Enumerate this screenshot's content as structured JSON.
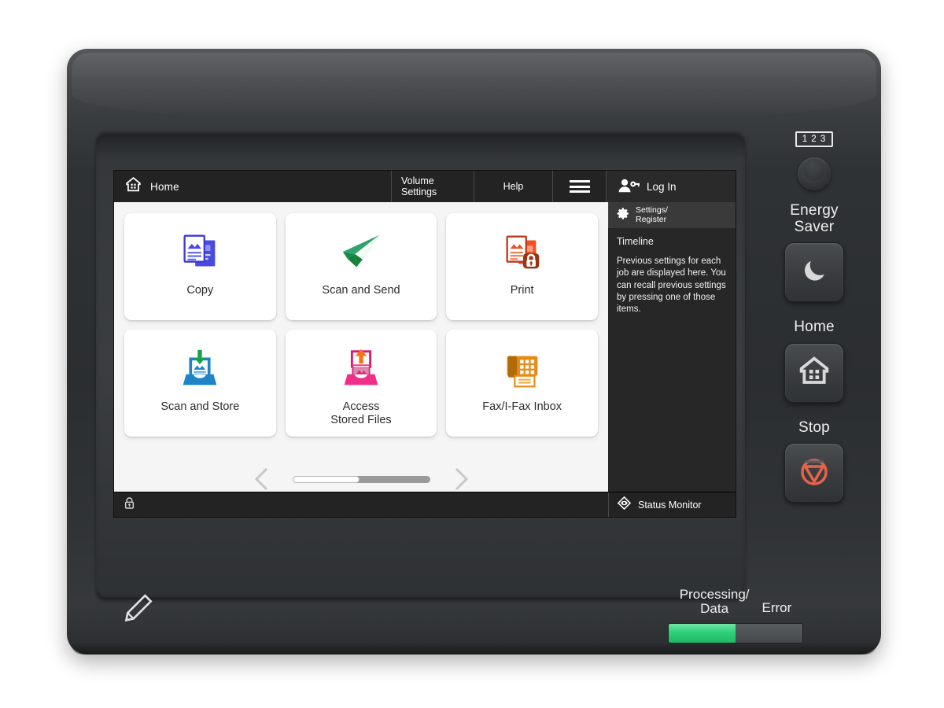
{
  "device": {
    "name": "multifunction-printer-control-panel"
  },
  "topbar": {
    "home_label": "Home",
    "home_icon": "home-icon",
    "volume_settings": "Volume Settings",
    "help": "Help",
    "menu_icon": "hamburger-menu-icon",
    "login_label": "Log In",
    "login_icon": "user-key-icon"
  },
  "tiles": [
    {
      "label": "Copy",
      "icon": "copy-documents-icon",
      "color": "#4a4ae0"
    },
    {
      "label": "Scan and Send",
      "icon": "paper-plane-icon",
      "color": "#1a8a4e"
    },
    {
      "label": "Print",
      "icon": "print-secure-documents-icon",
      "color": "#d4411e"
    },
    {
      "label": "Scan and Store",
      "icon": "scan-store-tray-icon",
      "color": "#1d84c8"
    },
    {
      "label": "Access\nStored Files",
      "label_line1": "Access",
      "label_line2": "Stored Files",
      "icon": "access-stored-files-tray-icon",
      "color": "#ef2f88"
    },
    {
      "label": "Fax/I-Fax Inbox",
      "icon": "fax-machine-icon",
      "color": "#e88a16"
    }
  ],
  "pager": {
    "prev_icon": "chevron-left-icon",
    "next_icon": "chevron-right-icon",
    "scroll_position_percent": 49
  },
  "sidepanel": {
    "settings_line1": "Settings/",
    "settings_line2": "Register",
    "settings_icon": "gear-icon",
    "timeline_title": "Timeline",
    "timeline_description": "Previous settings for each job are displayed here. You can recall previous settings by pressing one of those items."
  },
  "statusbar": {
    "lock_icon": "lock-icon",
    "status_monitor_label": "Status Monitor",
    "status_monitor_icon": "eye-diamond-icon"
  },
  "hardware": {
    "keypad_badge": "1 2 3",
    "keypad_icon": "numeric-keypad-icon",
    "energy_saver_line1": "Energy",
    "energy_saver_line2": "Saver",
    "energy_saver_icon": "moon-icon",
    "home_label": "Home",
    "home_icon": "home-button-icon",
    "stop_label": "Stop",
    "stop_icon": "stop-triangle-icon"
  },
  "lower": {
    "pencil_icon": "stylus-pencil-icon",
    "processing_line1": "Processing/",
    "processing_line2": "Data",
    "error_label": "Error",
    "processing_led_state": "on-green",
    "error_led_state": "off"
  },
  "colors": {
    "screen_bg": "#f5f5f5",
    "topbar_bg": "#232323",
    "sidepanel_bg": "#272727",
    "led_green": "#2fd07a",
    "stop_red": "#e8624a"
  }
}
